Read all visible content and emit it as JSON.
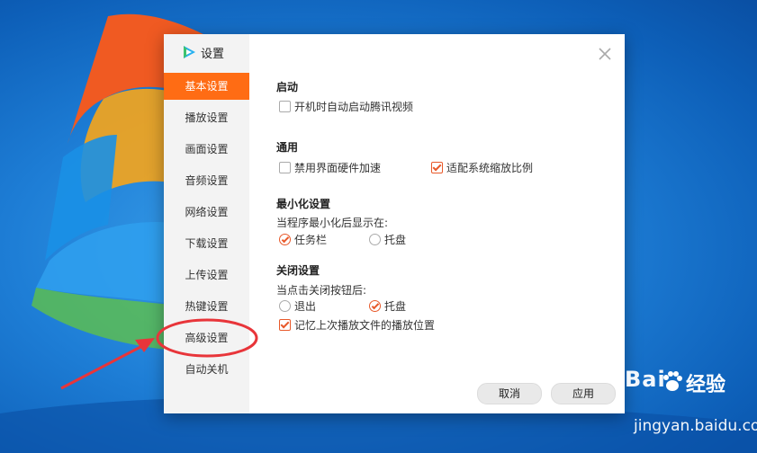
{
  "dialog": {
    "title": "设置",
    "close_icon": "close-icon",
    "nav": [
      {
        "label": "基本设置",
        "active": true
      },
      {
        "label": "播放设置",
        "active": false
      },
      {
        "label": "画面设置",
        "active": false
      },
      {
        "label": "音频设置",
        "active": false
      },
      {
        "label": "网络设置",
        "active": false
      },
      {
        "label": "下载设置",
        "active": false
      },
      {
        "label": "上传设置",
        "active": false
      },
      {
        "label": "热键设置",
        "active": false
      },
      {
        "label": "高级设置",
        "active": false
      },
      {
        "label": "自动关机",
        "active": false
      }
    ],
    "sections": {
      "startup": {
        "title": "启动",
        "autostart": {
          "label": "开机时自动启动腾讯视频",
          "checked": false
        }
      },
      "general": {
        "title": "通用",
        "disable_hw_accel": {
          "label": "禁用界面硬件加速",
          "checked": false
        },
        "fit_scaling": {
          "label": "适配系统缩放比例",
          "checked": true
        }
      },
      "minimize": {
        "title": "最小化设置",
        "prompt": "当程序最小化后显示在:",
        "taskbar": {
          "label": "任务栏",
          "selected": true
        },
        "tray": {
          "label": "托盘",
          "selected": false
        }
      },
      "close": {
        "title": "关闭设置",
        "prompt": "当点击关闭按钮后:",
        "exit": {
          "label": "退出",
          "selected": false
        },
        "tray": {
          "label": "托盘",
          "selected": true
        },
        "remember_position": {
          "label": "记忆上次播放文件的播放位置",
          "checked": true
        }
      }
    },
    "buttons": {
      "cancel": "取消",
      "apply": "应用"
    }
  },
  "colors": {
    "accent": "#ff6c14",
    "check": "#e8592a"
  },
  "watermark": {
    "brand_left": "Bai",
    "brand_right": "经验",
    "url": "jingyan.baidu.com"
  }
}
